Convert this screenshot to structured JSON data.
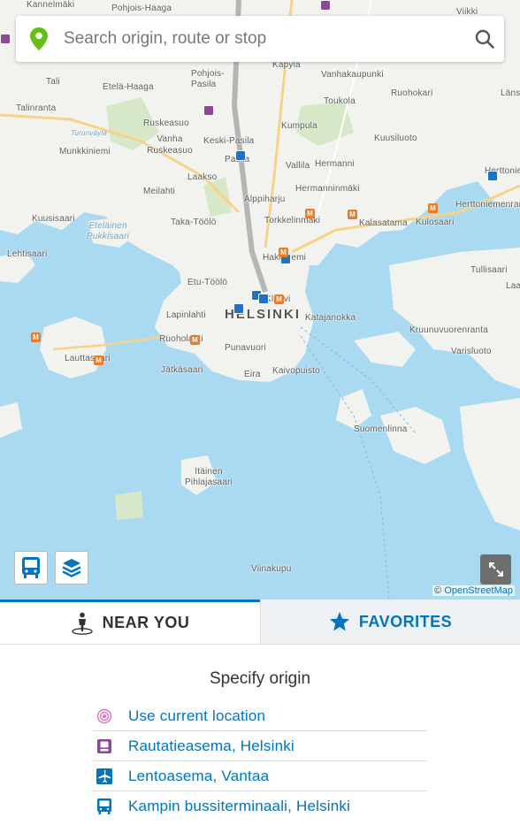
{
  "search": {
    "placeholder": "Search origin, route or stop"
  },
  "map": {
    "labels": [
      "Kannelmäki",
      "Pohjois-Haaga",
      "Käpylä",
      "Vanhakaupunki",
      "Viikki",
      "Tali",
      "Etelä-Haaga",
      "Pohjois-Pasila",
      "Toukola",
      "Ruohokari",
      "Länsi-Herttoniemi",
      "Talinranta",
      "Turunväylä",
      "Ruskeasuo",
      "Kumpula",
      "Kuusiluoto",
      "Vanha Ruskeasuo",
      "Keski-Pasila",
      "Munkkiniemi",
      "Pasila",
      "Vallila",
      "Hermanni",
      "Herttoniemi",
      "Laakso",
      "Meilahti",
      "Alppiharju",
      "Hermanninmäki",
      "Herttoniemenranta",
      "Kuusisaari",
      "Taka-Töölö",
      "Torkkelinmäki",
      "Kalasatama",
      "Kulosaari",
      "Eteläinen Pukkisaari",
      "Lehtisaari",
      "Hakaniemi",
      "Tullisaari",
      "Etu-Töölö",
      "Kluuvi",
      "Laajasalo",
      "HELSINKI",
      "Katajanokka",
      "Lapinlahti",
      "Kruunuvuorenranta",
      "Ruoholahti",
      "Punavuori",
      "Varisluoto",
      "Lauttasaari",
      "Jätkäsaari",
      "Eira",
      "Kaivopuisto",
      "Suomenlinna",
      "Itäinen Pihlajasaari",
      "Viinakupu"
    ],
    "attribution_symbol": "©",
    "attribution_link": "OpenStreetMap",
    "colors": {
      "water": "#aadaf2",
      "land": "#f2f2ee",
      "accent": "#0074bf"
    }
  },
  "controls": {
    "bus_icon": "bus-icon",
    "layers_icon": "layers-icon",
    "expand_icon": "expand-icon"
  },
  "tabs": {
    "nearby": {
      "label": "NEAR YOU",
      "icon": "person-location-icon"
    },
    "favorites": {
      "label": "FAVORITES",
      "icon": "star-icon"
    }
  },
  "origin": {
    "title": "Specify origin",
    "items": [
      {
        "label": "Use current location",
        "icon": "target-icon"
      },
      {
        "label": "Rautatieasema, Helsinki",
        "icon": "train-icon"
      },
      {
        "label": "Lentoasema, Vantaa",
        "icon": "airplane-icon"
      },
      {
        "label": "Kampin bussiterminaali, Helsinki",
        "icon": "bus-icon"
      }
    ]
  }
}
